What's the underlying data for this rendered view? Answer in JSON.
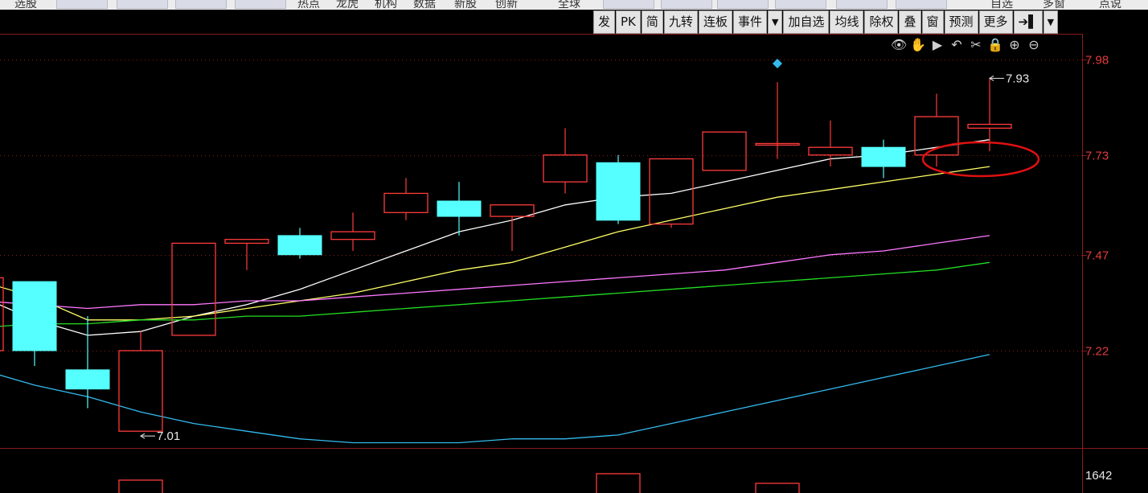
{
  "topnav": {
    "items": [
      {
        "label": "选股",
        "x": 18
      },
      {
        "label": "热点",
        "x": 370
      },
      {
        "label": "龙虎",
        "x": 418
      },
      {
        "label": "机构",
        "x": 466
      },
      {
        "label": "数据",
        "x": 514
      },
      {
        "label": "新股",
        "x": 565
      },
      {
        "label": "创新",
        "x": 616
      },
      {
        "label": "全球",
        "x": 694
      },
      {
        "label": "自选",
        "x": 1232
      },
      {
        "label": "多窗",
        "x": 1297
      },
      {
        "label": "点说",
        "x": 1367
      }
    ]
  },
  "toolbar": {
    "buttons": [
      "发",
      "PK",
      "简",
      "九转",
      "连板",
      "事件",
      "▼",
      "加自选",
      "均线",
      "除权",
      "叠",
      "窗",
      "预测",
      "更多",
      "➔▌",
      "▼"
    ]
  },
  "tool_icons": [
    {
      "name": "eye-icon",
      "glyph": "👁"
    },
    {
      "name": "hand-icon",
      "glyph": "✋"
    },
    {
      "name": "play-icon",
      "glyph": "▶"
    },
    {
      "name": "undo-icon",
      "glyph": "↶"
    },
    {
      "name": "scissors-icon",
      "glyph": "✂"
    },
    {
      "name": "lock-icon",
      "glyph": "🔒"
    },
    {
      "name": "zoom-in-icon",
      "glyph": "⊕"
    },
    {
      "name": "zoom-out-icon",
      "glyph": "⊖"
    }
  ],
  "colors": {
    "up": "#ff3b3b",
    "down": "#55ffff",
    "ma_white": "#ffffff",
    "ma_yellow": "#ffff66",
    "ma_pink": "#ff77ff",
    "ma_green": "#22dd22",
    "ma_cyan": "#33bbee",
    "grid": "#8b1a1a"
  },
  "chart_data": {
    "type": "candlestick",
    "y_ticks": [
      "7.98",
      "7.73",
      "7.47",
      "7.22"
    ],
    "ylim": [
      6.85,
      8.05
    ],
    "candles": [
      {
        "o": 7.22,
        "c": 7.41,
        "h": 7.41,
        "l": 7.2
      },
      {
        "o": 7.4,
        "c": 7.22,
        "h": 7.28,
        "l": 7.18
      },
      {
        "o": 7.17,
        "c": 7.12,
        "h": 7.31,
        "l": 7.07
      },
      {
        "o": 7.01,
        "c": 7.22,
        "h": 7.27,
        "l": 7.01
      },
      {
        "o": 7.26,
        "c": 7.5,
        "h": 7.5,
        "l": 7.26
      },
      {
        "o": 7.5,
        "c": 7.51,
        "h": 7.51,
        "l": 7.43
      },
      {
        "o": 7.52,
        "c": 7.47,
        "h": 7.54,
        "l": 7.46
      },
      {
        "o": 7.51,
        "c": 7.53,
        "h": 7.58,
        "l": 7.48
      },
      {
        "o": 7.58,
        "c": 7.63,
        "h": 7.67,
        "l": 7.56
      },
      {
        "o": 7.61,
        "c": 7.57,
        "h": 7.66,
        "l": 7.52
      },
      {
        "o": 7.57,
        "c": 7.6,
        "h": 7.6,
        "l": 7.48
      },
      {
        "o": 7.66,
        "c": 7.73,
        "h": 7.8,
        "l": 7.63
      },
      {
        "o": 7.71,
        "c": 7.56,
        "h": 7.73,
        "l": 7.55
      },
      {
        "o": 7.55,
        "c": 7.72,
        "h": 7.72,
        "l": 7.54
      },
      {
        "o": 7.69,
        "c": 7.79,
        "h": 7.79,
        "l": 7.69
      },
      {
        "o": 7.76,
        "c": 7.76,
        "h": 7.92,
        "l": 7.72
      },
      {
        "o": 7.73,
        "c": 7.75,
        "h": 7.82,
        "l": 7.7
      },
      {
        "o": 7.75,
        "c": 7.7,
        "h": 7.77,
        "l": 7.67
      },
      {
        "o": 7.73,
        "c": 7.83,
        "h": 7.89,
        "l": 7.7
      },
      {
        "o": 7.8,
        "c": 7.81,
        "h": 7.93,
        "l": 7.74
      }
    ],
    "ma_lines": [
      {
        "color": "#ffffff",
        "values": [
          7.36,
          7.3,
          7.26,
          7.27,
          7.31,
          7.34,
          7.38,
          7.43,
          7.48,
          7.53,
          7.56,
          7.6,
          7.62,
          7.63,
          7.66,
          7.69,
          7.72,
          7.73,
          7.75,
          7.77
        ]
      },
      {
        "color": "#ffff66",
        "values": [
          7.4,
          7.36,
          7.3,
          7.3,
          7.31,
          7.33,
          7.35,
          7.37,
          7.4,
          7.43,
          7.45,
          7.49,
          7.53,
          7.56,
          7.59,
          7.62,
          7.64,
          7.66,
          7.68,
          7.7
        ]
      },
      {
        "color": "#ff77ff",
        "values": [
          7.35,
          7.34,
          7.33,
          7.34,
          7.34,
          7.35,
          7.35,
          7.36,
          7.37,
          7.38,
          7.39,
          7.4,
          7.41,
          7.42,
          7.43,
          7.45,
          7.47,
          7.48,
          7.5,
          7.52
        ]
      },
      {
        "color": "#22dd22",
        "values": [
          7.28,
          7.29,
          7.29,
          7.3,
          7.3,
          7.31,
          7.31,
          7.32,
          7.33,
          7.34,
          7.35,
          7.36,
          7.37,
          7.38,
          7.39,
          7.4,
          7.41,
          7.42,
          7.43,
          7.45
        ]
      },
      {
        "color": "#33bbee",
        "values": [
          7.17,
          7.13,
          7.1,
          7.06,
          7.03,
          7.01,
          6.99,
          6.98,
          6.98,
          6.98,
          6.99,
          6.99,
          7.0,
          7.03,
          7.06,
          7.09,
          7.12,
          7.15,
          7.18,
          7.21
        ]
      }
    ],
    "annotations": {
      "high_label": "7.93",
      "low_label": "7.01",
      "volume_label": "1642"
    },
    "volume": [
      null,
      null,
      null,
      0.4,
      null,
      null,
      null,
      null,
      null,
      null,
      null,
      null,
      0.6,
      null,
      null,
      0.3,
      null,
      null,
      null,
      null
    ]
  }
}
